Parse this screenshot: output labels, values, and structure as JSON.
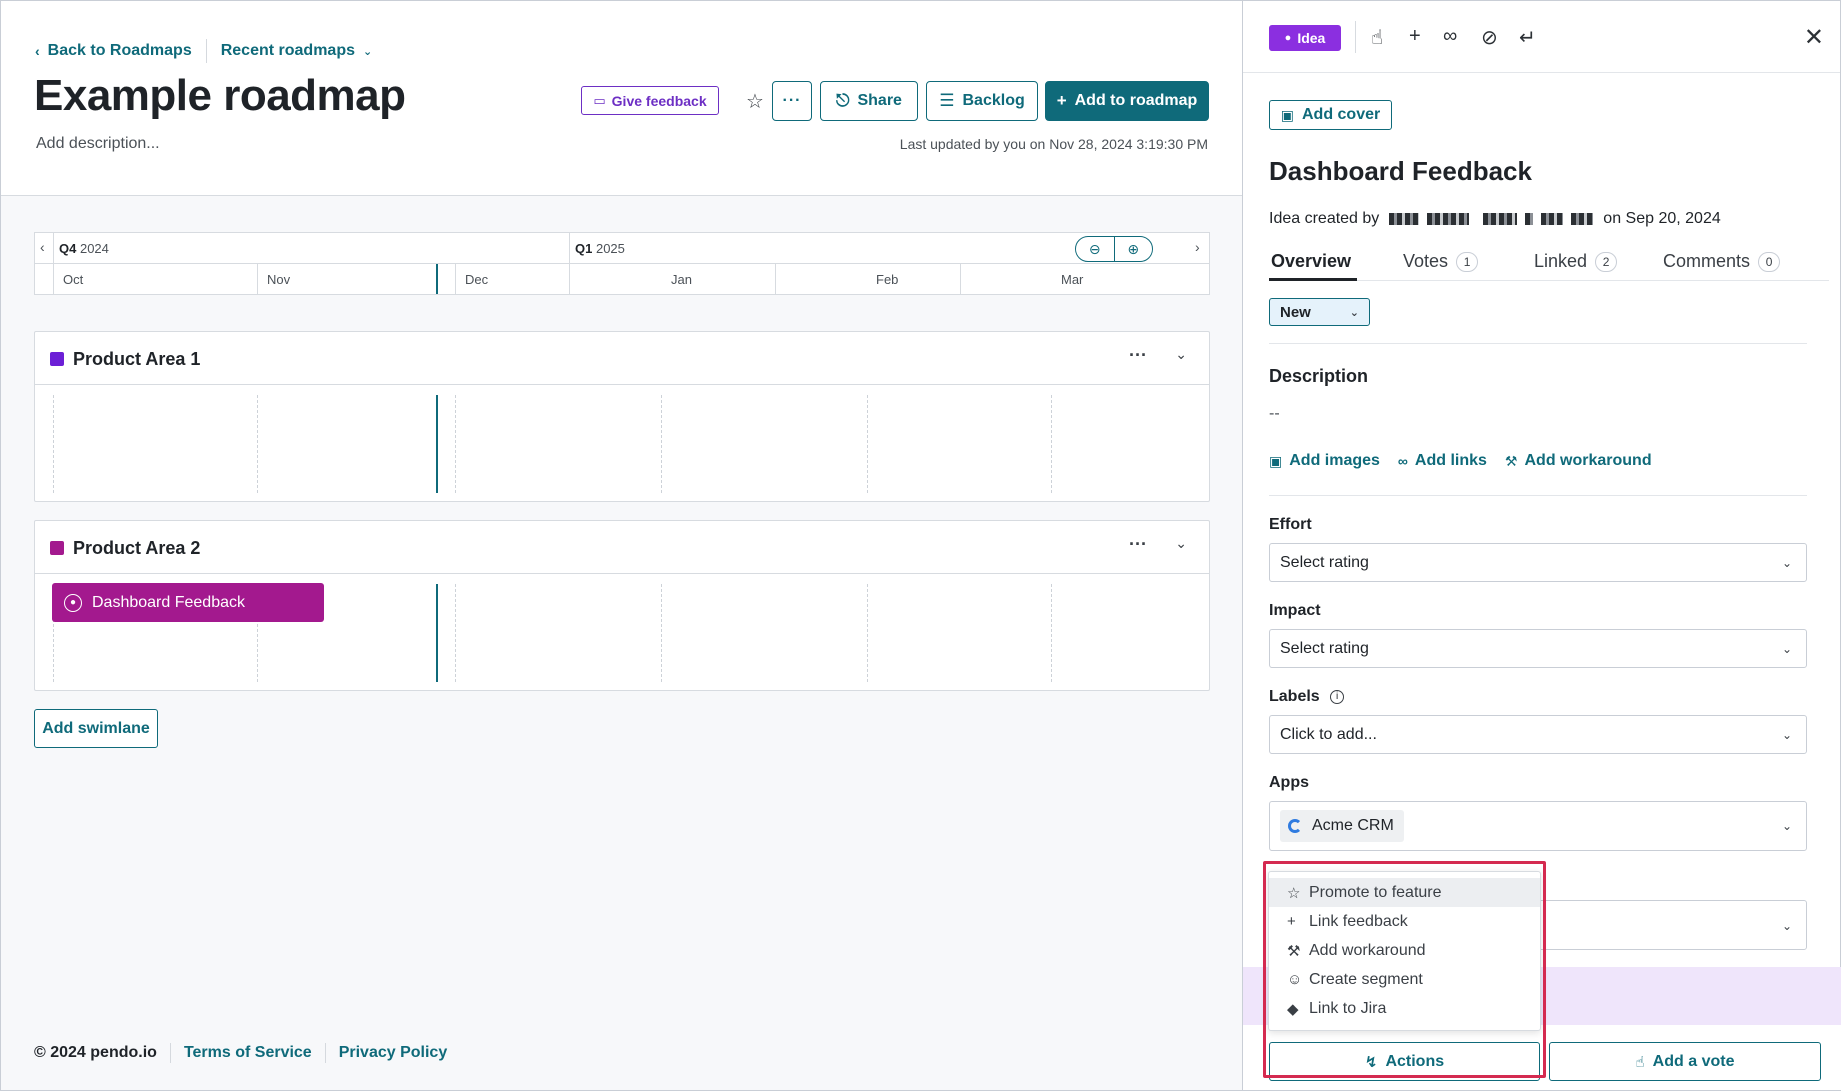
{
  "nav": {
    "back_label": "Back to Roadmaps",
    "recent_label": "Recent roadmaps"
  },
  "roadmap": {
    "title": "Example roadmap",
    "description_placeholder": "Add description...",
    "last_updated": "Last updated by you on Nov 28, 2024 3:19:30 PM"
  },
  "toolbar": {
    "feedback_label": "Give feedback",
    "share_label": "Share",
    "backlog_label": "Backlog",
    "add_label": "Add to roadmap"
  },
  "timeline": {
    "quarters": [
      {
        "q": "Q4",
        "year": "2024"
      },
      {
        "q": "Q1",
        "year": "2025"
      }
    ],
    "months": [
      "Oct",
      "Nov",
      "Dec",
      "Jan",
      "Feb",
      "Mar"
    ]
  },
  "swimlanes": [
    {
      "title": "Product Area 1",
      "color": "#6c1fd6"
    },
    {
      "title": "Product Area 2",
      "color": "#a3198e"
    }
  ],
  "roadmap_item": {
    "label": "Dashboard Feedback",
    "color": "#a3198e"
  },
  "add_swimlane_label": "Add swimlane",
  "footer": {
    "copyright": "© 2024 pendo.io",
    "terms": "Terms of Service",
    "privacy": "Privacy Policy"
  },
  "panel": {
    "badge": "Idea",
    "add_cover": "Add cover",
    "title": "Dashboard Feedback",
    "created_prefix": "Idea created by",
    "created_suffix": "on Sep 20, 2024",
    "tabs": [
      {
        "label": "Overview",
        "count": ""
      },
      {
        "label": "Votes",
        "count": "1"
      },
      {
        "label": "Linked",
        "count": "2"
      },
      {
        "label": "Comments",
        "count": "0"
      }
    ],
    "status": "New",
    "description_label": "Description",
    "description_value": "--",
    "add_images": "Add images",
    "add_links": "Add links",
    "add_workaround": "Add workaround",
    "effort_label": "Effort",
    "effort_value": "Select rating",
    "impact_label": "Impact",
    "impact_value": "Select rating",
    "labels_label": "Labels",
    "labels_placeholder": "Click to add...",
    "apps_label": "Apps",
    "apps_value": "Acme CRM",
    "actions_label": "Actions",
    "vote_label": "Add a vote"
  },
  "actions_menu": [
    {
      "label": "Promote to feature",
      "icon": "star-icon"
    },
    {
      "label": "Link feedback",
      "icon": "plus-icon"
    },
    {
      "label": "Add workaround",
      "icon": "wrench-icon"
    },
    {
      "label": "Create segment",
      "icon": "user-plus-icon"
    },
    {
      "label": "Link to Jira",
      "icon": "jira-icon"
    }
  ],
  "colors": {
    "accent": "#0f6a7a",
    "idea_badge": "#8b2fe0",
    "highlight": "#d42a50"
  }
}
